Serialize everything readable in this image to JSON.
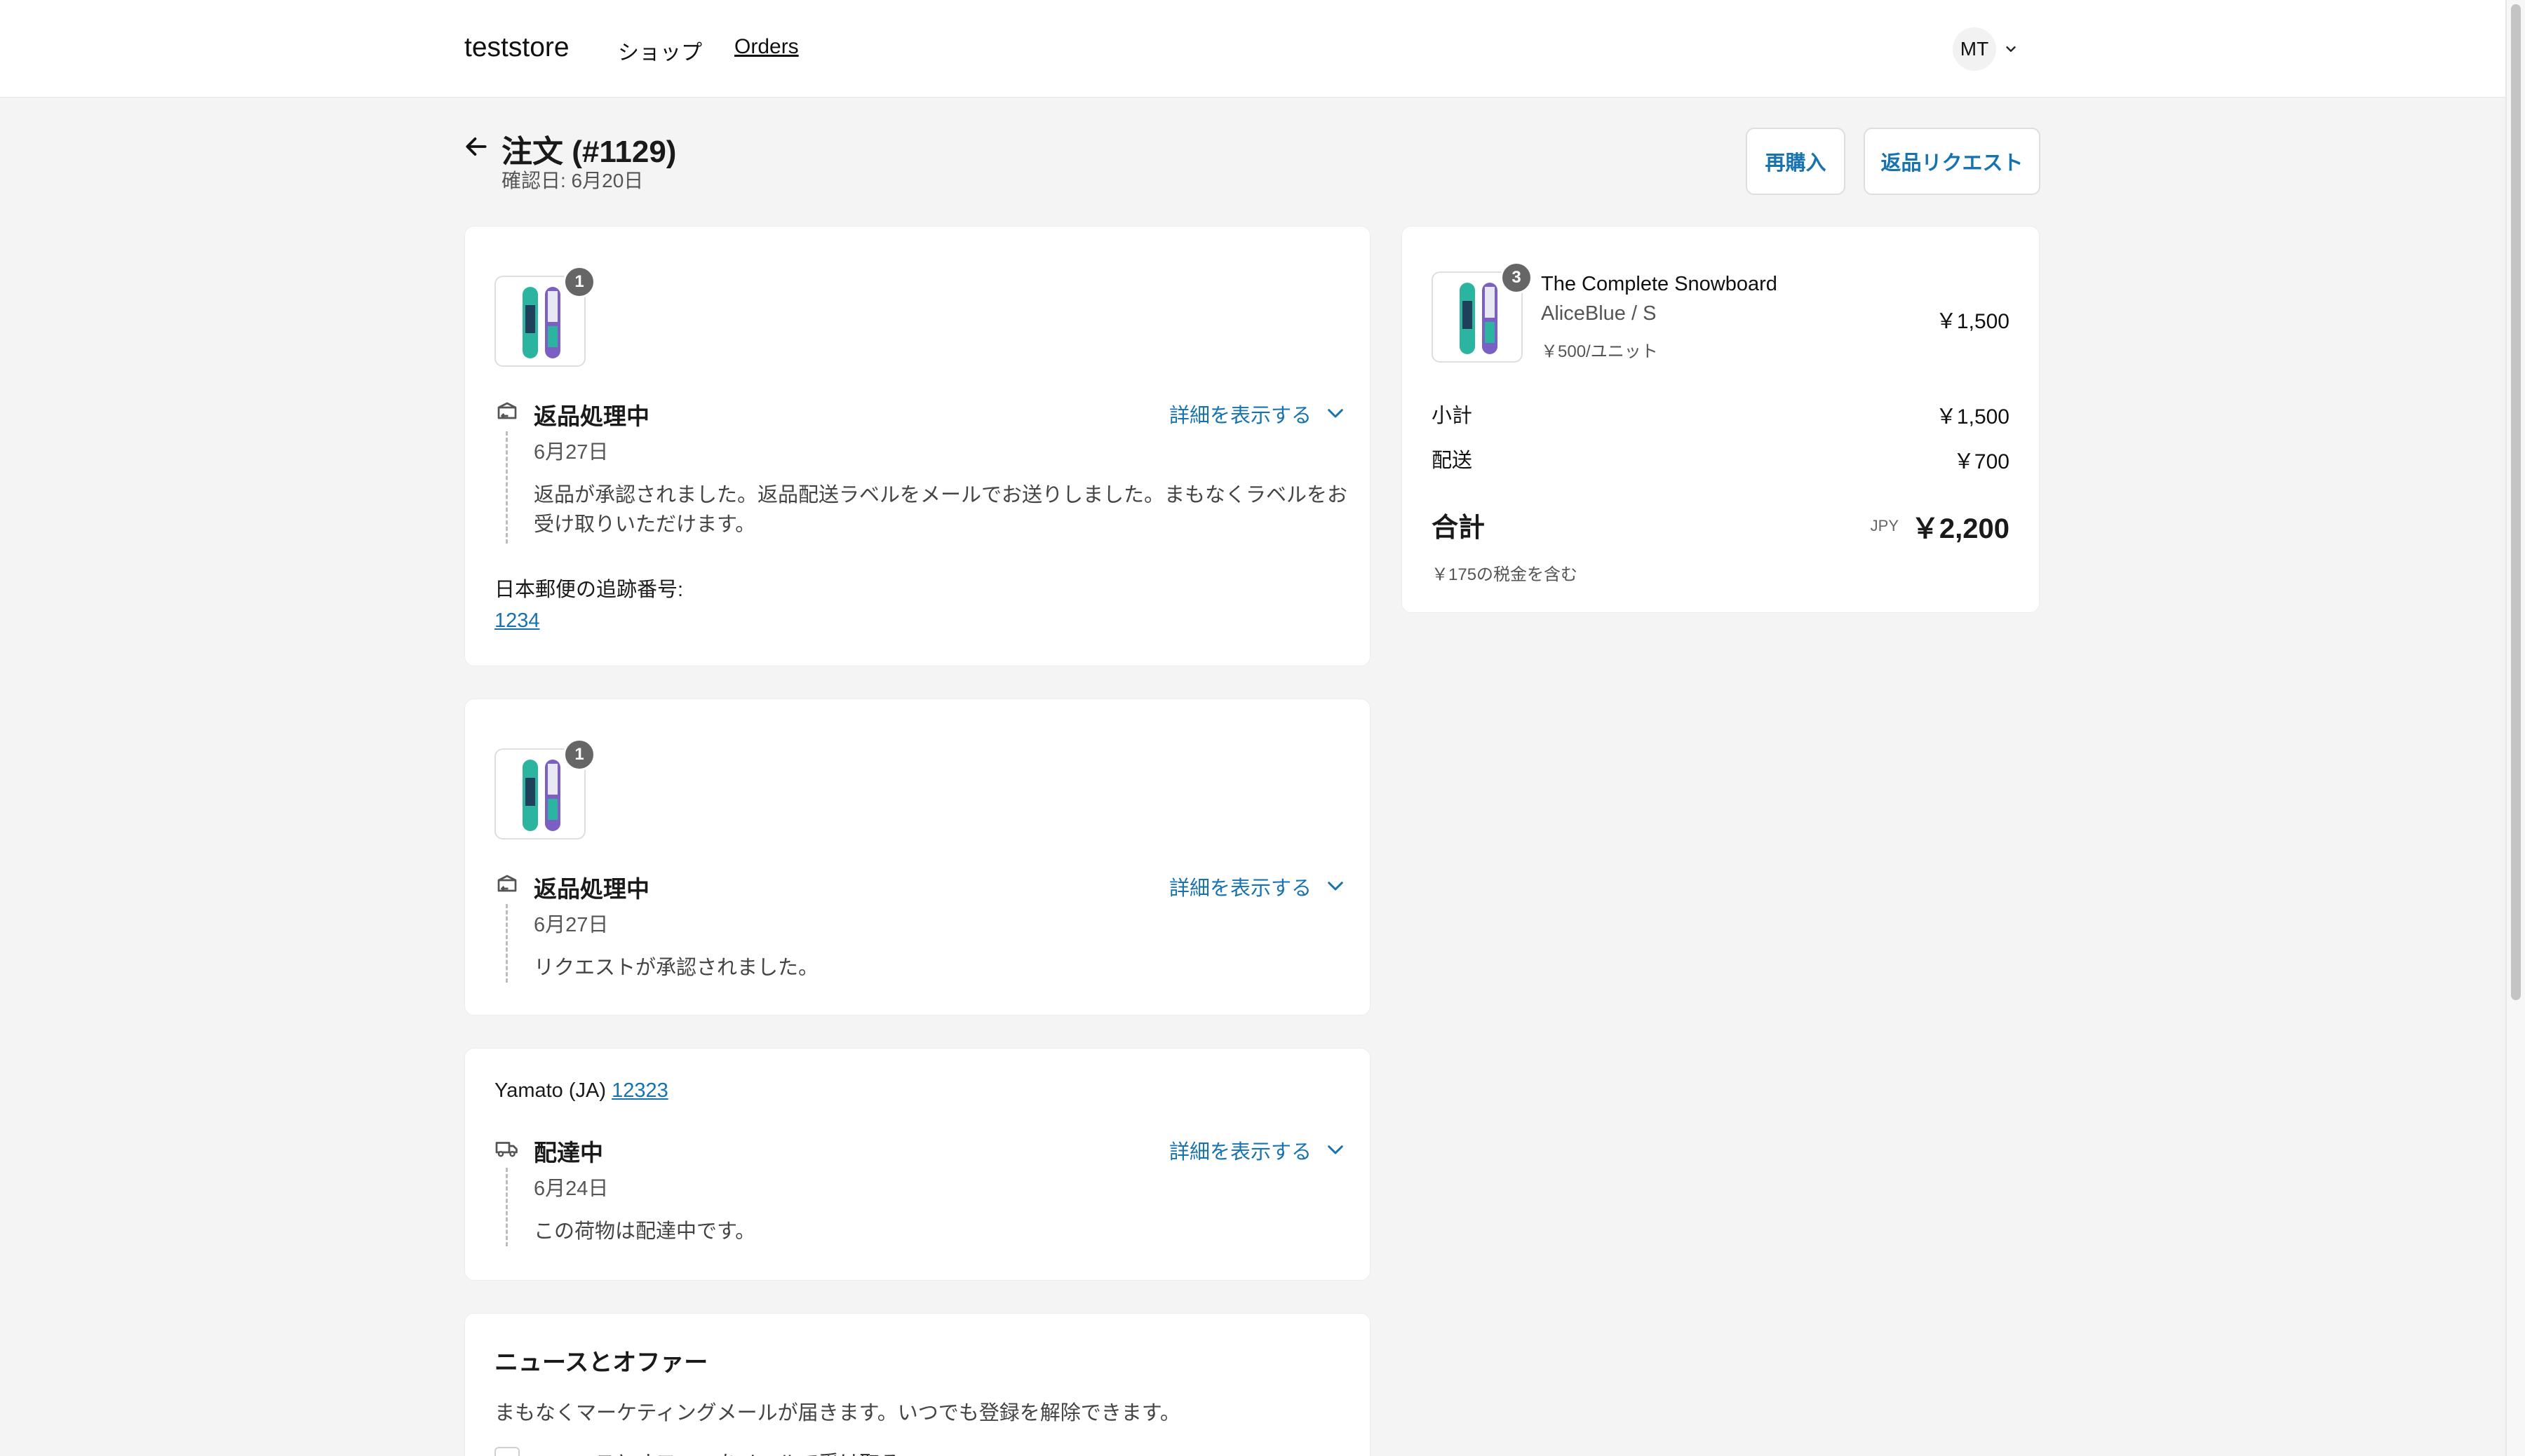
{
  "header": {
    "store_name": "teststore",
    "nav": {
      "shop": "ショップ",
      "orders": "Orders"
    },
    "account_initials": "MT"
  },
  "order": {
    "title": "注文 (#1129)",
    "confirmed_date": "確認日: 6月20日",
    "reorder_label": "再購入",
    "return_request_label": "返品リクエスト"
  },
  "fulfillments": [
    {
      "qty": "1",
      "status": "返品処理中",
      "date": "6月27日",
      "message": "返品が承認されました。返品配送ラベルをメールでお送りしました。まもなくラベルをお受け取りいただけます。",
      "details_label": "詳細を表示する",
      "tracking_label": "日本郵便の追跡番号:",
      "tracking_number": "1234"
    },
    {
      "qty": "1",
      "status": "返品処理中",
      "date": "6月27日",
      "message": "リクエストが承認されました。",
      "details_label": "詳細を表示する"
    },
    {
      "carrier": "Yamato (JA)",
      "tracking_number": "12323",
      "status": "配達中",
      "date": "6月24日",
      "message": "この荷物は配達中です。",
      "details_label": "詳細を表示する"
    }
  ],
  "newsletter": {
    "title": "ニュースとオファー",
    "text": "まもなくマーケティングメールが届きます。いつでも登録を解除できます。",
    "checkbox_label": "ニュースとオファーをメールで受け取る"
  },
  "summary": {
    "product_name": "The Complete Snowboard",
    "variant": "AliceBlue / S",
    "unit_price": "￥500/ユニット",
    "qty": "3",
    "line_price": "￥1,500",
    "subtotal_label": "小計",
    "subtotal": "￥1,500",
    "shipping_label": "配送",
    "shipping": "￥700",
    "total_label": "合計",
    "currency": "JPY",
    "total": "￥2,200",
    "tax_note": "￥175の税金を含む"
  },
  "colors": {
    "accent": "#1773b0",
    "background": "#f4f4f4",
    "card": "#ffffff",
    "snowboard_teal": "#2bb5a0",
    "snowboard_purple": "#7b5fc4"
  }
}
